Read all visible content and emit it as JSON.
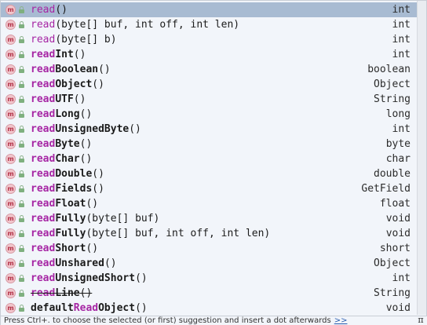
{
  "items": [
    {
      "prefix": "read",
      "rest": "()",
      "type": "int",
      "bold": false,
      "strike": false,
      "selected": true
    },
    {
      "prefix": "read",
      "rest": "(byte[] buf, int off, int len)",
      "type": "int",
      "bold": false,
      "strike": false
    },
    {
      "prefix": "read",
      "rest": "(byte[] b)",
      "type": "int",
      "bold": false,
      "strike": false
    },
    {
      "prefix": "read",
      "bold_part": "Int",
      "rest": "()",
      "type": "int",
      "bold": true,
      "strike": false
    },
    {
      "prefix": "read",
      "bold_part": "Boolean",
      "rest": "()",
      "type": "boolean",
      "bold": true,
      "strike": false
    },
    {
      "prefix": "read",
      "bold_part": "Object",
      "rest": "()",
      "type": "Object",
      "bold": true,
      "strike": false
    },
    {
      "prefix": "read",
      "bold_part": "UTF",
      "rest": "()",
      "type": "String",
      "bold": true,
      "strike": false
    },
    {
      "prefix": "read",
      "bold_part": "Long",
      "rest": "()",
      "type": "long",
      "bold": true,
      "strike": false
    },
    {
      "prefix": "read",
      "bold_part": "UnsignedByte",
      "rest": "()",
      "type": "int",
      "bold": true,
      "strike": false
    },
    {
      "prefix": "read",
      "bold_part": "Byte",
      "rest": "()",
      "type": "byte",
      "bold": true,
      "strike": false
    },
    {
      "prefix": "read",
      "bold_part": "Char",
      "rest": "()",
      "type": "char",
      "bold": true,
      "strike": false
    },
    {
      "prefix": "read",
      "bold_part": "Double",
      "rest": "()",
      "type": "double",
      "bold": true,
      "strike": false
    },
    {
      "prefix": "read",
      "bold_part": "Fields",
      "rest": "()",
      "type": "GetField",
      "bold": true,
      "strike": false
    },
    {
      "prefix": "read",
      "bold_part": "Float",
      "rest": "()",
      "type": "float",
      "bold": true,
      "strike": false
    },
    {
      "prefix": "read",
      "bold_part": "Fully",
      "rest": "(byte[] buf)",
      "type": "void",
      "bold": true,
      "strike": false
    },
    {
      "prefix": "read",
      "bold_part": "Fully",
      "rest": "(byte[] buf, int off, int len)",
      "type": "void",
      "bold": true,
      "strike": false
    },
    {
      "prefix": "read",
      "bold_part": "Short",
      "rest": "()",
      "type": "short",
      "bold": true,
      "strike": false
    },
    {
      "prefix": "read",
      "bold_part": "Unshared",
      "rest": "()",
      "type": "Object",
      "bold": true,
      "strike": false
    },
    {
      "prefix": "read",
      "bold_part": "UnsignedShort",
      "rest": "()",
      "type": "int",
      "bold": true,
      "strike": false
    },
    {
      "prefix": "read",
      "bold_part": "Line",
      "rest": "()",
      "type": "String",
      "bold": true,
      "strike": true
    },
    {
      "pre": "default",
      "prefix": "Read",
      "bold_part": "Object",
      "rest": "()",
      "type": "void",
      "bold": true,
      "strike": false,
      "default_style": true
    }
  ],
  "icon": {
    "method_letter": "m"
  },
  "footer": {
    "hint": "Press Ctrl+. to choose the selected (or first) suggestion and insert a dot afterwards",
    "more_link": ">>",
    "pi": "π"
  }
}
